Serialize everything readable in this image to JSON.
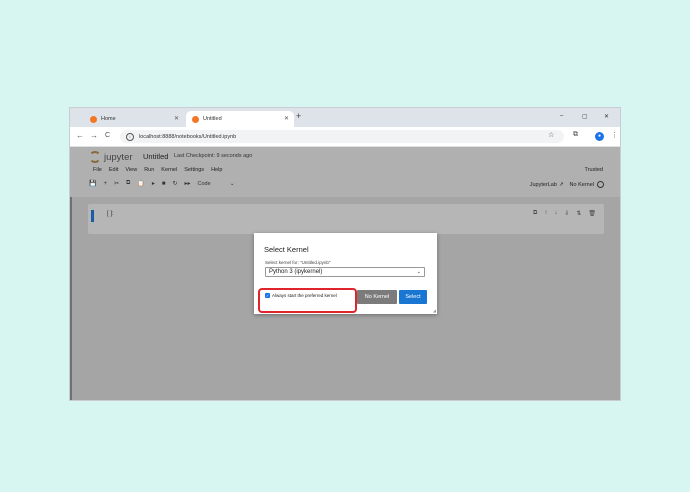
{
  "browser": {
    "tabs": [
      {
        "title": "Home",
        "active": false
      },
      {
        "title": "Untitled",
        "active": true
      }
    ],
    "new_tab": "+",
    "url": "localhost:8888/notebooks/Untitled.ipynb",
    "window_controls": {
      "minimize": "–",
      "restore": "▢",
      "close": "✕"
    },
    "nav": {
      "back": "←",
      "forward": "→",
      "reload": "C"
    },
    "icons": {
      "star": "☆",
      "extensions": "⧉",
      "profile": "●",
      "menu": "⋮"
    }
  },
  "jupyter": {
    "logo_text": "jupyter",
    "notebook_title": "Untitled",
    "checkpoint": "Last Checkpoint: 9 seconds ago",
    "menu": [
      "File",
      "Edit",
      "View",
      "Run",
      "Kernel",
      "Settings",
      "Help"
    ],
    "trusted": "Trusted",
    "toolbar_icons": [
      "💾",
      "+",
      "✂",
      "⧉",
      "📋",
      "▸",
      "■",
      "↻",
      "▸▸"
    ],
    "cell_type": "Code",
    "cell_type_chevron": "⌄",
    "jupyterlab_link": "JupyterLab",
    "jupyterlab_icon": "↗",
    "kernel_status": "No Kernel",
    "cell_prompt": "[ ]:",
    "cell_icons": [
      "⧉",
      "↑",
      "↓",
      "⇩",
      "⇅",
      "🗑"
    ]
  },
  "dialog": {
    "title": "Select Kernel",
    "label": "Select kernel for: \"Untitled.ipynb\"",
    "selected_kernel": "Python 3 (ipykernel)",
    "select_chevron": "⌄",
    "checkbox_label": "Always start the preferred kernel",
    "checkbox_checked": true,
    "checkbox_mark": "✓",
    "no_kernel_button": "No Kernel",
    "select_button": "Select"
  },
  "annotation_color": "#e0242b"
}
